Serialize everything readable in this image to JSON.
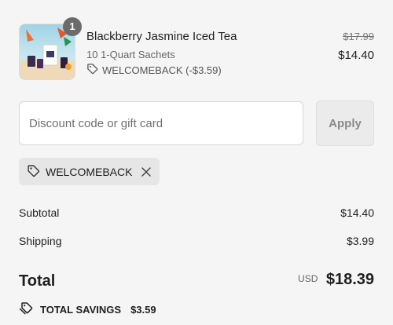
{
  "product": {
    "quantity": "1",
    "title": "Blackberry Jasmine Iced Tea",
    "variant": "10 1-Quart Sachets",
    "discount_line": "WELCOMEBACK (-$3.59)",
    "original_price": "$17.99",
    "price": "$14.40",
    "discount_icon": "tag-icon"
  },
  "discount": {
    "placeholder": "Discount code or gift card",
    "value": "",
    "apply_label": "Apply"
  },
  "applied_code": {
    "code": "WELCOMEBACK",
    "icon": "tag-icon",
    "remove_icon": "close-icon"
  },
  "summary": {
    "subtotal_label": "Subtotal",
    "subtotal_value": "$14.40",
    "shipping_label": "Shipping",
    "shipping_value": "$3.99",
    "total_label": "Total",
    "currency": "USD",
    "total_value": "$18.39",
    "savings_label": "TOTAL SAVINGS",
    "savings_value": "$3.59",
    "savings_icon": "tags-icon"
  }
}
